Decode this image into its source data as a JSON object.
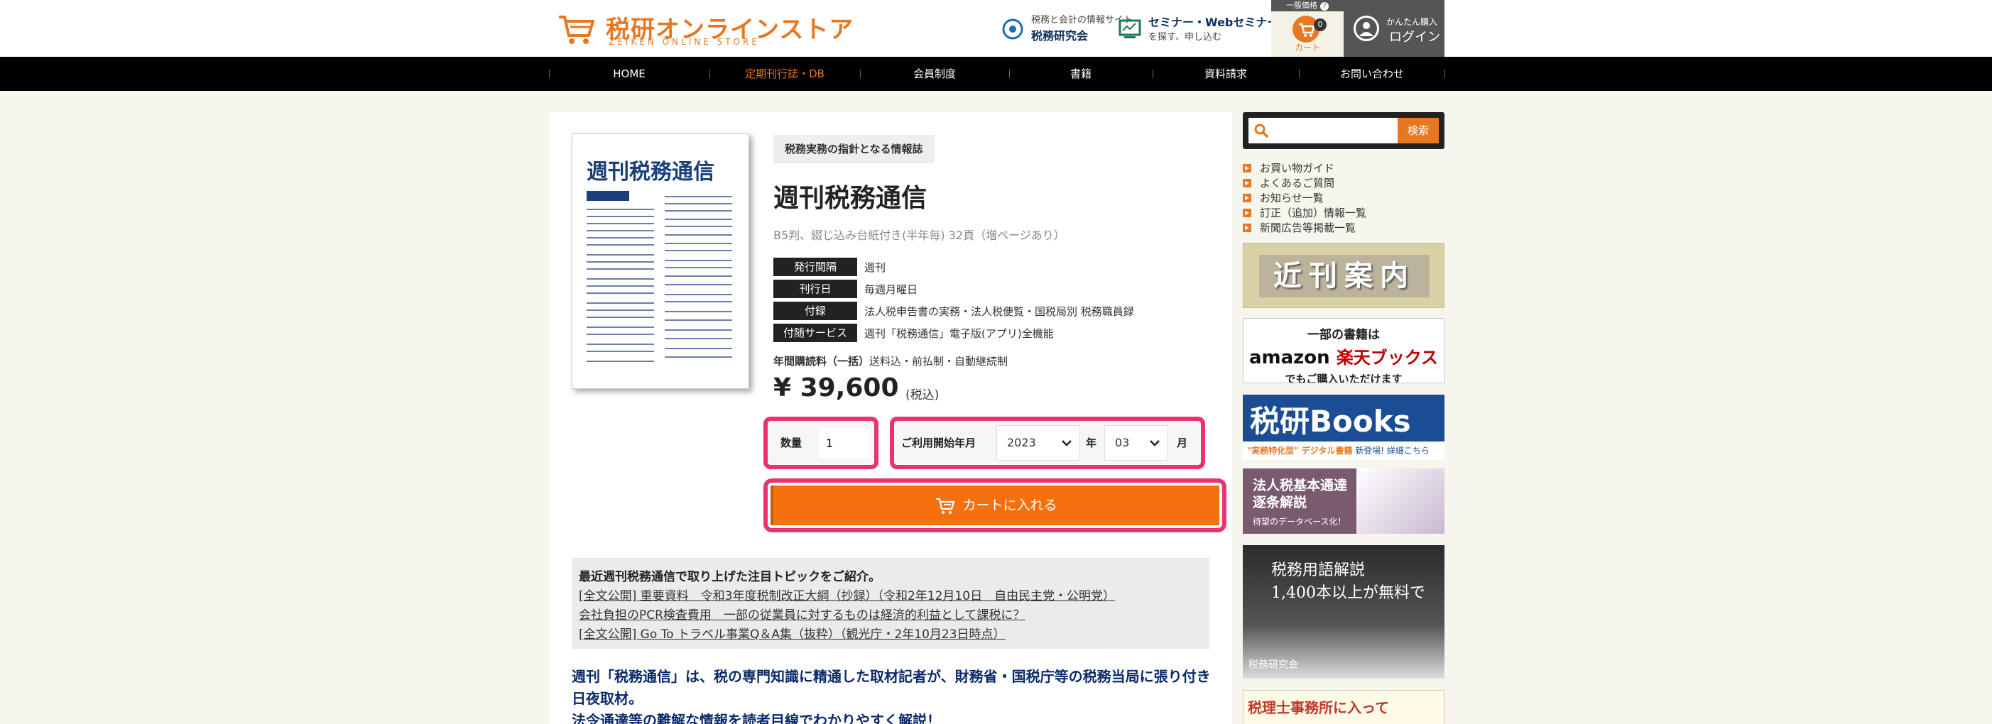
{
  "header": {
    "logo_title": "税研オンラインストア",
    "logo_sub": "ZEIKEN ONLINE STORE",
    "link1_small": "税務と会計の情報サイト",
    "link1_big": "税務研究会",
    "link2_big": "セミナー・Webセミナー",
    "link2_small": "を探す、申し込む",
    "cart_top": "一般価格",
    "cart_count": "0",
    "cart_label": "カート",
    "login_small": "かんたん購入",
    "login_big": "ログイン"
  },
  "nav": {
    "items": [
      "HOME",
      "定期刊行誌・DB",
      "会員制度",
      "書籍",
      "資料請求",
      "お問い合わせ"
    ],
    "active_color": "#e87722"
  },
  "product": {
    "cover_title": "週刊税務通信",
    "tagline": "税務実務の指針となる情報誌",
    "title": "週刊税務通信",
    "subtitle": "B5判、綴じ込み台紙付き(半年毎) 32頁（増ページあり）",
    "specs": [
      {
        "label": "発行間隔",
        "value": "週刊"
      },
      {
        "label": "刊行日",
        "value": "毎週月曜日"
      },
      {
        "label": "付録",
        "value": "法人税申告書の実務・法人税便覧・国税局別 税務職員録"
      },
      {
        "label": "付随サービス",
        "value": "週刊「税務通信」電子版(アプリ)全機能"
      }
    ],
    "sub_note_bold": "年間購読料（一括）",
    "sub_note": "送料込・前払制・自動継続制",
    "price": "¥ 39,600",
    "price_tax": "(税込)",
    "qty_label": "数量",
    "qty_value": "1",
    "date_label": "ご利用開始年月",
    "year_value": "2023",
    "year_unit": "年",
    "month_value": "03",
    "month_unit": "月",
    "add_to_cart": "カートに入れる"
  },
  "topics": {
    "heading": "最近週刊税務通信で取り上げた注目トピックをご紹介。",
    "links": [
      "[全文公開] 重要資料　令和3年度税制改正大綱（抄録）（令和2年12月10日　自由民主党・公明党）",
      "会社負担のPCR検査費用　一部の従業員に対するものは経済的利益として課税に？",
      "[全文公開] Go To トラベル事業Q＆A集（抜粋）（観光庁・2年10月23日時点）"
    ]
  },
  "description": {
    "line1": "週刊「税務通信」は、税の専門知識に精通した取材記者が、財務省・国税庁等の税務当局に張り付き日夜取材。",
    "line2": "法令通達等の難解な情報を読者目線でわかりやすく解説！"
  },
  "sidebar": {
    "search_button": "検索",
    "search_placeholder": "",
    "links": [
      "お買い物ガイド",
      "よくあるご質問",
      "お知らせ一覧",
      "訂正（追加）情報一覧",
      "新聞広告等掲載一覧"
    ],
    "banner1": "近刊案内",
    "banner2_t1": "一部の書籍は",
    "banner2_amazon": "amazon",
    "banner2_rakuten": "楽天ブックス",
    "banner2_t3": "でもご購入いただけます",
    "banner3_title": "税研Books",
    "banner3_sub_bold": "\"実務特化型\" デジタル書籍",
    "banner3_sub": "新登場! 詳細こちら",
    "banner4_t1": "法人税基本通達",
    "banner4_t2": "逐条解説",
    "banner4_t3": "待望のデータベース化！",
    "banner5_l1": "税務用語解説",
    "banner5_l2": "1,400本以上が無料で",
    "banner5_logo": "税務研究会",
    "banner6": "税理士事務所に入って"
  }
}
